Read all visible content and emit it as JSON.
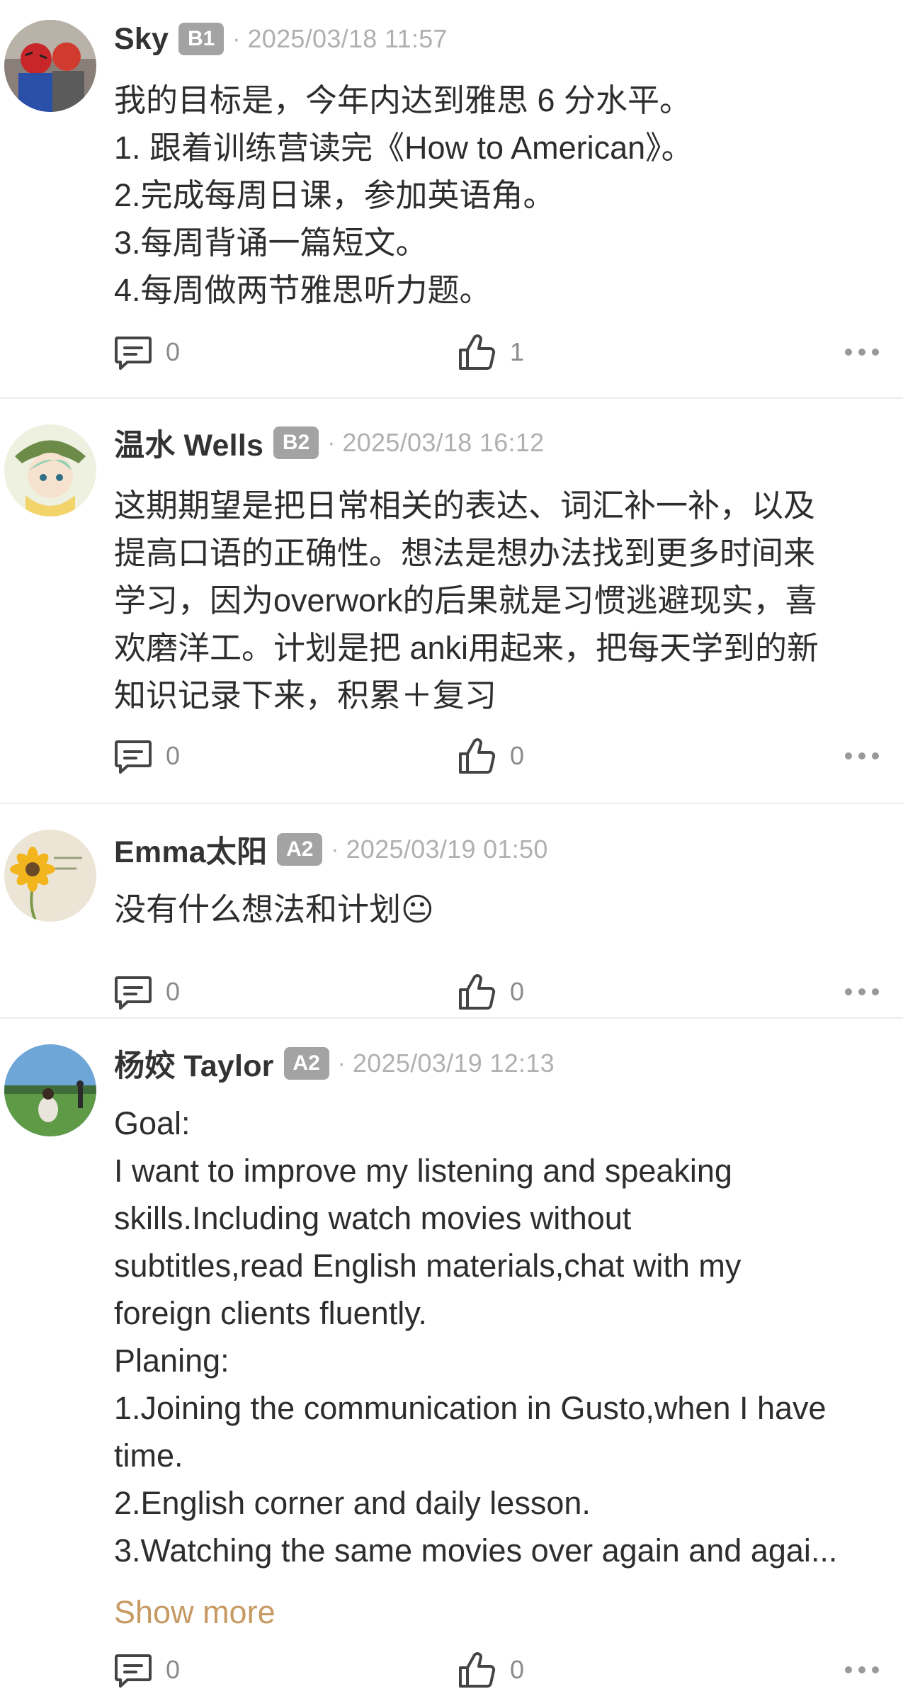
{
  "posts": [
    {
      "name": "Sky",
      "level": "B1",
      "time": "2025/03/18 11:57",
      "lines": [
        "我的目标是，今年内达到雅思 6 分水平。",
        "1. 跟着训练营读完《How to American》。",
        "2.完成每周日课，参加英语角。",
        "3.每周背诵一篇短文。",
        "4.每周做两节雅思听力题。"
      ],
      "comments": "0",
      "likes": "1"
    },
    {
      "name": "温水 Wells",
      "level": "B2",
      "time": "2025/03/18 16:12",
      "lines": [
        "这期期望是把日常相关的表达、词汇补一补，以及",
        "提高口语的正确性。想法是想办法找到更多时间来",
        "学习，因为overwork的后果就是习惯逃避现实，喜",
        "欢磨洋工。计划是把 anki用起来，把每天学到的新",
        "知识记录下来，积累＋复习"
      ],
      "comments": "0",
      "likes": "0"
    },
    {
      "name": "Emma太阳",
      "level": "A2",
      "time": "2025/03/19 01:50",
      "lines": [
        "没有什么想法和计划😐"
      ],
      "comments": "0",
      "likes": "0"
    },
    {
      "name": "杨姣 Taylor",
      "level": "A2",
      "time": "2025/03/19 12:13",
      "lines": [
        "Goal:",
        "I want to improve my listening and speaking",
        "skills.Including watch movies without",
        "subtitles,read English materials,chat with my",
        "foreign clients fluently.",
        "Planing:",
        "1.Joining the communication in Gusto,when I have",
        "time.",
        "2.English corner and daily lesson.",
        "3.Watching the same movies over again and agai..."
      ],
      "show_more": "Show more",
      "comments": "0",
      "likes": "0"
    }
  ],
  "icons": {
    "comment": "comment-icon",
    "like": "thumbs-up-icon",
    "more": "more-dots-icon"
  },
  "colors": {
    "accent": "#c79a63",
    "badge": "#a3a3a3",
    "meta": "#b0b0b0",
    "divider": "#ececec"
  }
}
